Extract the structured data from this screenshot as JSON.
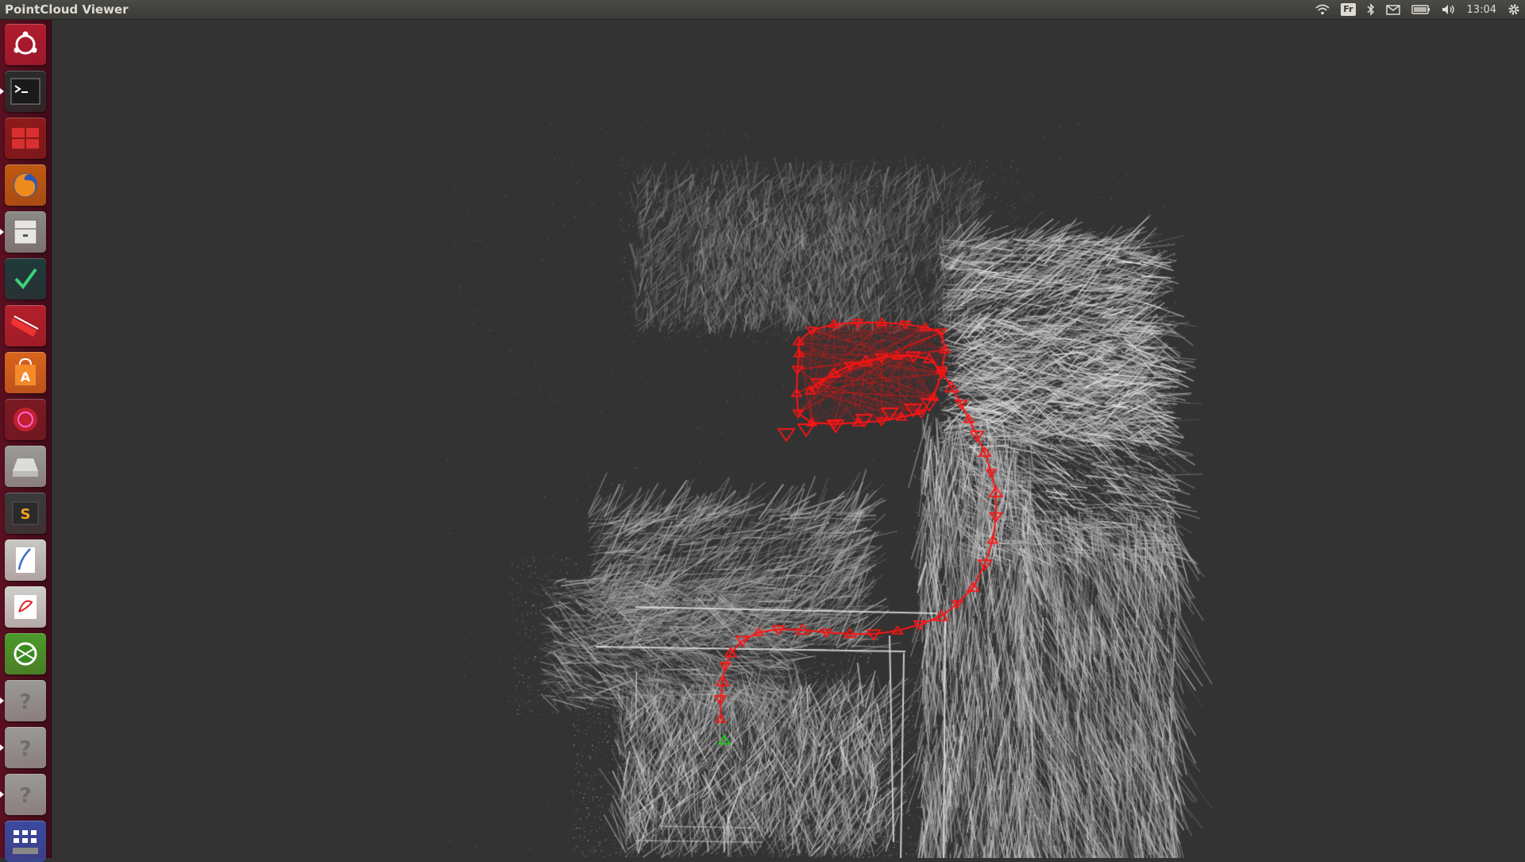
{
  "window": {
    "title": "PointCloud Viewer"
  },
  "panel": {
    "keyboard_layout": "Fr",
    "clock": "13:04",
    "indicators": [
      "wifi-icon",
      "keyboard-layout-indicator",
      "bluetooth-icon",
      "mail-icon",
      "battery-icon",
      "volume-icon",
      "clock",
      "session-gear-icon"
    ]
  },
  "launcher": {
    "items": [
      {
        "name": "dash-home",
        "icon": "ubuntu-logo-icon",
        "color": "#b01c2e",
        "running": false
      },
      {
        "name": "terminal",
        "icon": "terminal-icon",
        "color": "#2b2b2b",
        "running": true
      },
      {
        "name": "workspace-switcher",
        "icon": "workspaces-icon",
        "color": "#8c1a1a",
        "running": false
      },
      {
        "name": "firefox",
        "icon": "firefox-icon",
        "color": "#c05a12",
        "running": false
      },
      {
        "name": "files",
        "icon": "file-cabinet-icon",
        "color": "#8a8a86",
        "running": true
      },
      {
        "name": "app-green-check",
        "icon": "check-leaf-icon",
        "color": "#1f3a3a",
        "running": false
      },
      {
        "name": "app-red-book",
        "icon": "red-book-icon",
        "color": "#b3202a",
        "running": false
      },
      {
        "name": "software-center",
        "icon": "shopping-bag-icon",
        "color": "#d8641c",
        "running": false
      },
      {
        "name": "app-red-circle",
        "icon": "red-circle-icon",
        "color": "#7a1a22",
        "running": false
      },
      {
        "name": "disk",
        "icon": "drive-icon",
        "color": "#9a9a96",
        "running": false
      },
      {
        "name": "sublime-text",
        "icon": "sublime-icon",
        "color": "#3a3a3a",
        "running": false
      },
      {
        "name": "text-editor",
        "icon": "document-pen-icon",
        "color": "#c8c8c4",
        "running": false
      },
      {
        "name": "app-document",
        "icon": "document-red-icon",
        "color": "#d0cfcb",
        "running": false
      },
      {
        "name": "app-green-globe",
        "icon": "green-globe-icon",
        "color": "#4a9a2a",
        "running": false
      },
      {
        "name": "unknown-app-1",
        "icon": "question-icon",
        "color": "#9a9a96",
        "running": true
      },
      {
        "name": "unknown-app-2",
        "icon": "question-icon",
        "color": "#9a9a96",
        "running": true
      },
      {
        "name": "unknown-app-3",
        "icon": "question-icon",
        "color": "#9a9a96",
        "running": true
      },
      {
        "name": "workspace-grid",
        "icon": "grid-icon",
        "color": "#3a4aa0",
        "running": false
      }
    ]
  },
  "viewer": {
    "background": "#333333",
    "trajectory_color": "#ff1414",
    "current_pose_color": "#22cc22"
  }
}
